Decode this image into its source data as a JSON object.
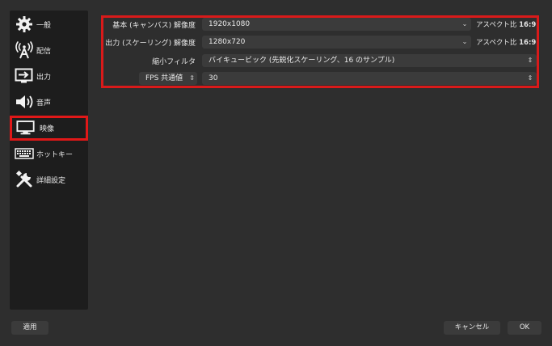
{
  "sidebar": {
    "items": [
      {
        "label": "一般",
        "icon": "gear-icon"
      },
      {
        "label": "配信",
        "icon": "broadcast-icon"
      },
      {
        "label": "出力",
        "icon": "output-icon"
      },
      {
        "label": "音声",
        "icon": "speaker-icon"
      },
      {
        "label": "映像",
        "icon": "monitor-icon"
      },
      {
        "label": "ホットキー",
        "icon": "keyboard-icon"
      },
      {
        "label": "詳細設定",
        "icon": "tools-icon"
      }
    ],
    "active_index": 4
  },
  "video": {
    "base_label": "基本 (キャンバス) 解像度",
    "base_value": "1920x1080",
    "base_aspect_prefix": "アスペクト比",
    "base_aspect_value": "16:9",
    "output_label": "出力 (スケーリング) 解像度",
    "output_value": "1280x720",
    "output_aspect_prefix": "アスペクト比",
    "output_aspect_value": "16:9",
    "filter_label": "縮小フィルタ",
    "filter_value": "バイキュービック (先鋭化スケーリング、16 のサンプル)",
    "fps_type": "FPS 共通値",
    "fps_value": "30"
  },
  "buttons": {
    "apply": "適用",
    "cancel": "キャンセル",
    "ok": "OK"
  },
  "colors": {
    "highlight": "#e01818",
    "background": "#2e2e2e",
    "sidebar": "#1d1d1d",
    "control": "#3b3b3b"
  }
}
